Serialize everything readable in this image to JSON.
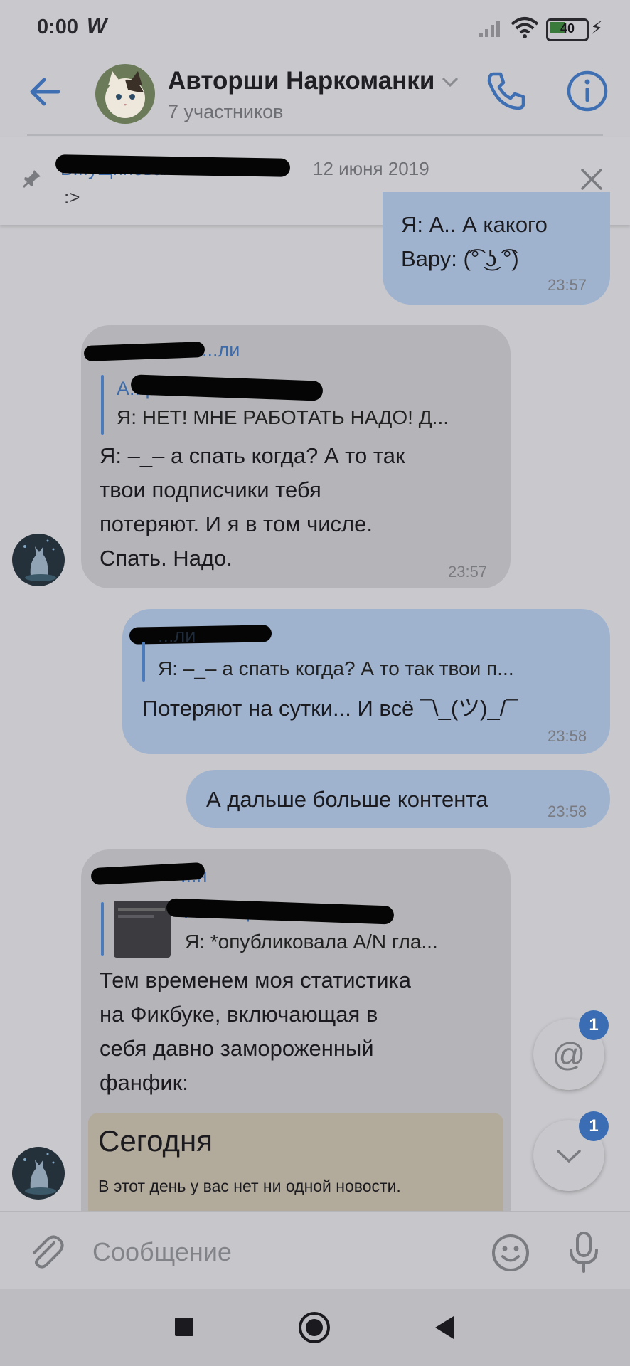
{
  "status_bar": {
    "time": "0:00",
    "app_glyph": "W",
    "battery": "40"
  },
  "header": {
    "title": "Авторши Наркоманки",
    "subtitle": "7 участников",
    "icons": [
      "back-arrow-icon",
      "chevron-down-icon",
      "phone-icon",
      "info-icon"
    ]
  },
  "pinned": {
    "author": "В...ущиновая",
    "date": "12 июня 2019",
    "text": ":>"
  },
  "messages": [
    {
      "direction": "out",
      "text": "Я: А.. А какого\nВару: (͡° ͜ʖ ͡°)",
      "time": "23:57"
    },
    {
      "direction": "in",
      "author": "...ли",
      "reply_name": "А...рова",
      "reply_text": "Я: НЕТ! МНЕ РАБОТАТЬ НАДО! Д...",
      "text": "Я: –_– а спать когда? А то так\nтвои подписчики тебя\nпотеряют. И я в том числе.\nСпать. Надо.",
      "time": "23:57"
    },
    {
      "direction": "out",
      "reply_name": "...ли",
      "reply_text": "Я: –_– а спать когда? А то так твои п...",
      "text": "Потеряют на сутки... И всё ¯\\_(ツ)_/¯",
      "time": "23:58"
    },
    {
      "direction": "out",
      "text": "А дальше больше контента",
      "time": "23:58"
    },
    {
      "direction": "in",
      "author": "...н",
      "reply_name": "Ана...бров",
      "reply_text": "Я: *опубликовала A/N гла...",
      "text": "Тем временем моя статистика\nна Фикбуке, включающая в\nсебя давно замороженный\nфанфик:",
      "time": "",
      "card_title": "Сегодня",
      "card_text": "В этот день у вас нет ни одной новости."
    }
  ],
  "fabs": {
    "mention_badge": "1",
    "scroll_badge": "1"
  },
  "composer": {
    "placeholder": "Сообщение"
  }
}
